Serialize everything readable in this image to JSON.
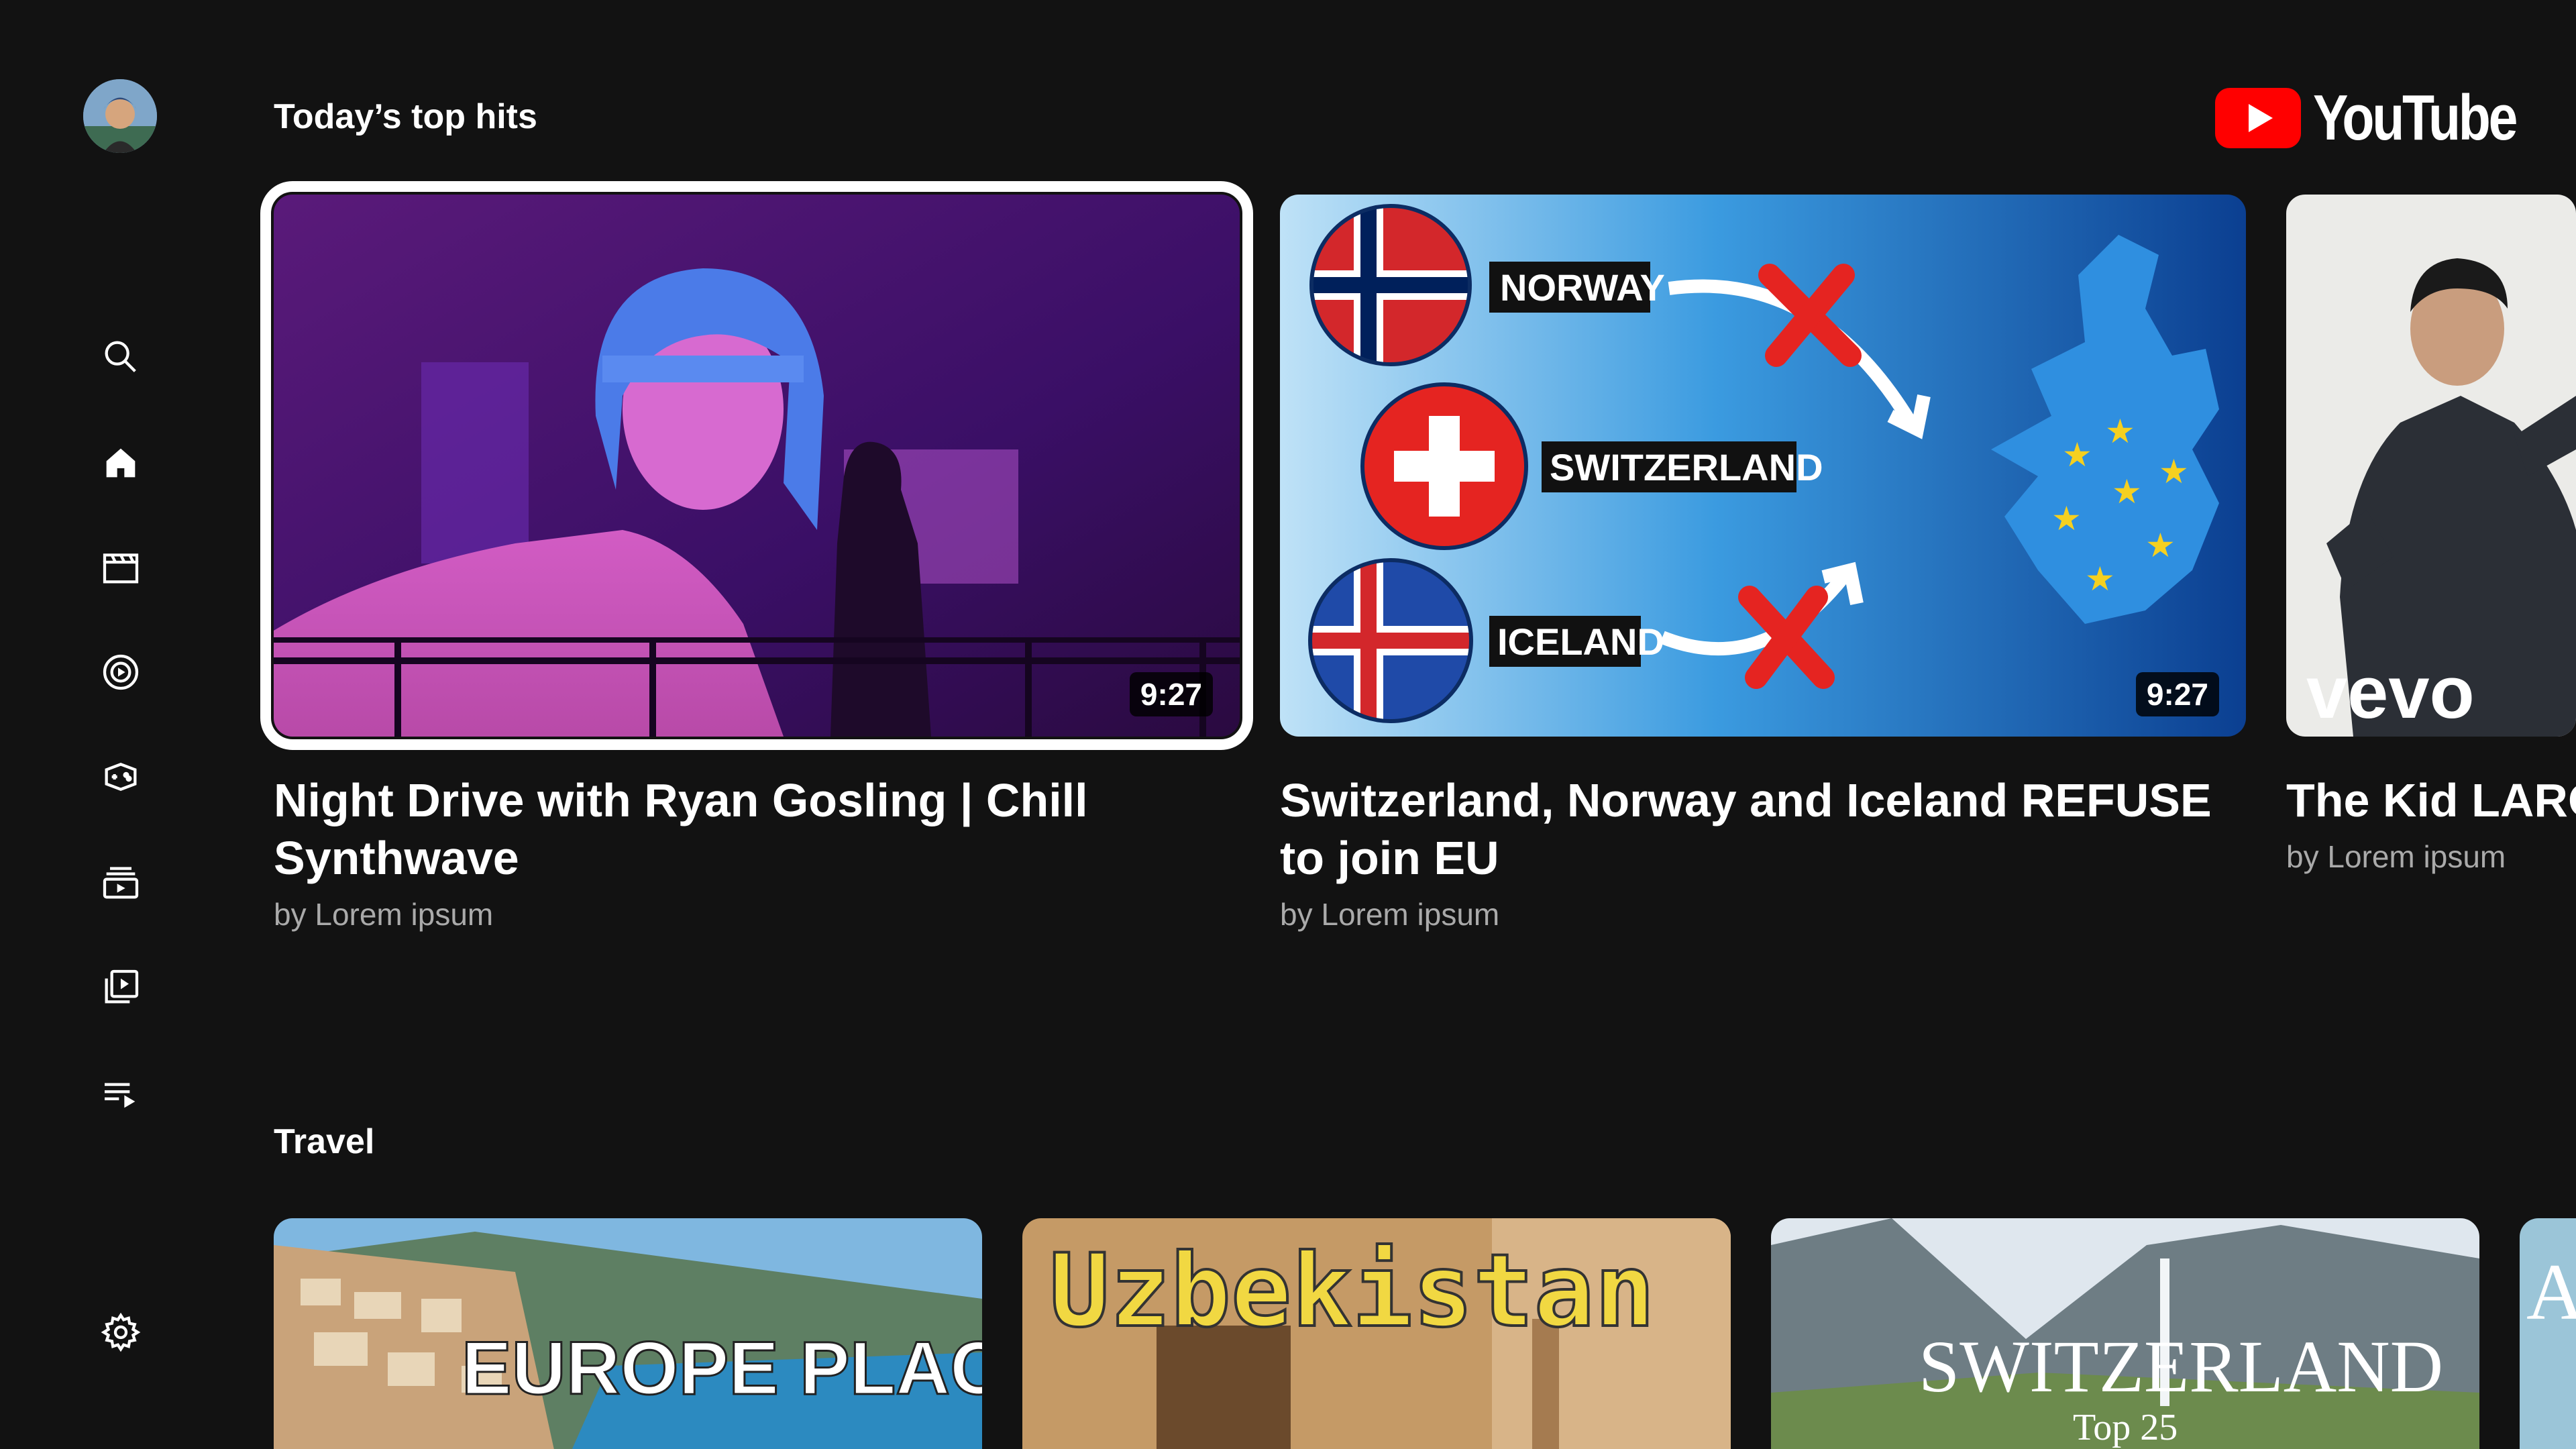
{
  "colors": {
    "background": "#121212",
    "accent": "#ff0000",
    "subtext": "#aaaaaa"
  },
  "sidebar": {
    "items": [
      {
        "name": "search",
        "icon": "search-icon"
      },
      {
        "name": "home",
        "icon": "home-icon",
        "active": true
      },
      {
        "name": "movies",
        "icon": "clapperboard-icon"
      },
      {
        "name": "music",
        "icon": "music-disc-icon"
      },
      {
        "name": "gaming",
        "icon": "gamepad-icon"
      },
      {
        "name": "subscriptions",
        "icon": "subscriptions-icon"
      },
      {
        "name": "library",
        "icon": "library-icon"
      },
      {
        "name": "queue",
        "icon": "queue-icon"
      },
      {
        "name": "settings",
        "icon": "gear-icon"
      }
    ]
  },
  "header": {
    "logo_text": "YouTube"
  },
  "sections": [
    {
      "title": "Today’s top hits",
      "videos": [
        {
          "title": "Night Drive with Ryan Gosling | Chill Synthwave",
          "channel": "by Lorem ipsum",
          "duration": "9:27",
          "focused": true
        },
        {
          "title": "Switzerland, Norway and Iceland REFUSE to join EU",
          "channel": "by Lorem ipsum",
          "duration": "9:27",
          "thumb_labels": {
            "norway": "NORWAY",
            "switzerland": "SWITZERLAND",
            "iceland": "ICELAND"
          }
        },
        {
          "title": "The Kid LAROI - TOO MUCH...",
          "channel": "by Lorem ipsum",
          "thumb_brand": "vevo"
        }
      ]
    },
    {
      "title": "Travel",
      "videos": [
        {
          "thumb_text": "EUROPE PLACES"
        },
        {
          "thumb_text": "Uzbekistan"
        },
        {
          "thumb_text": "SWITZERLAND",
          "thumb_subtext": "Top 25"
        },
        {
          "thumb_text": "A"
        }
      ]
    }
  ]
}
